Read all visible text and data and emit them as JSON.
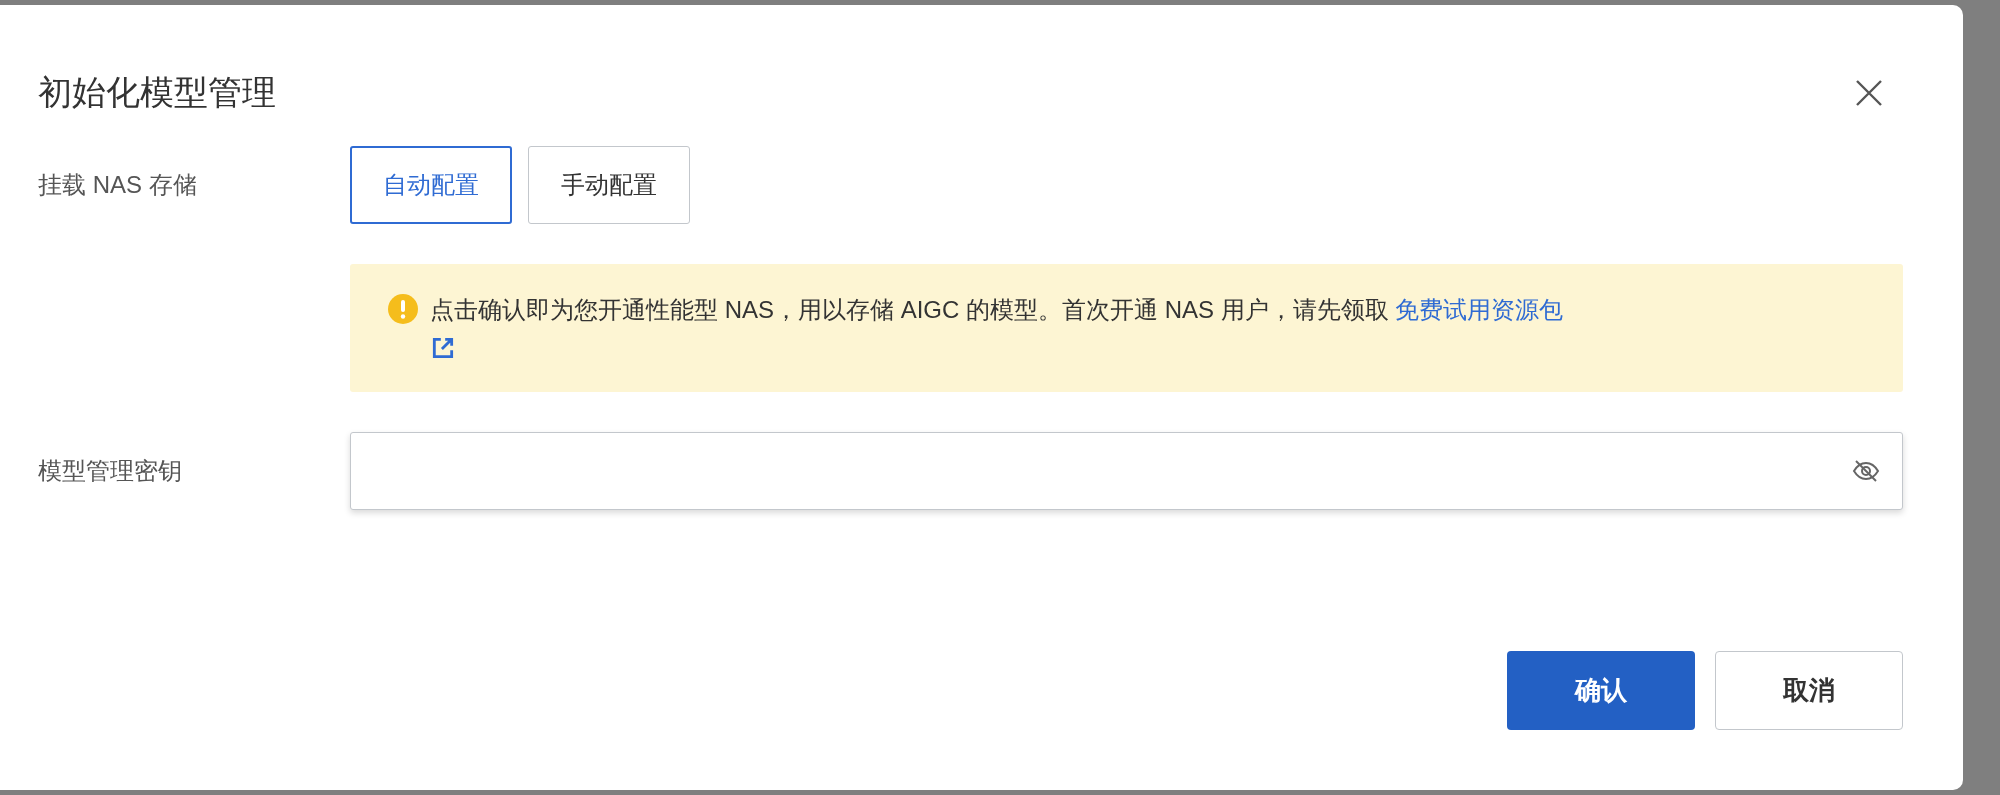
{
  "dialog": {
    "title": "初始化模型管理"
  },
  "fields": [
    {
      "kind": "segmented",
      "label": "挂载 NAS 存储",
      "options": [
        {
          "label": "自动配置",
          "selected": true
        },
        {
          "label": "手动配置",
          "selected": false
        }
      ]
    },
    {
      "kind": "notice",
      "text": "点击确认即为您开通性能型 NAS，用以存储 AIGC 的模型。首次开通 NAS 用户，请先领取",
      "link": "免费试用资源包"
    },
    {
      "kind": "password",
      "label": "模型管理密钥"
    }
  ],
  "buttons": [
    {
      "label": "确认",
      "kind": "primary"
    },
    {
      "label": "取消",
      "kind": "secondary"
    }
  ]
}
